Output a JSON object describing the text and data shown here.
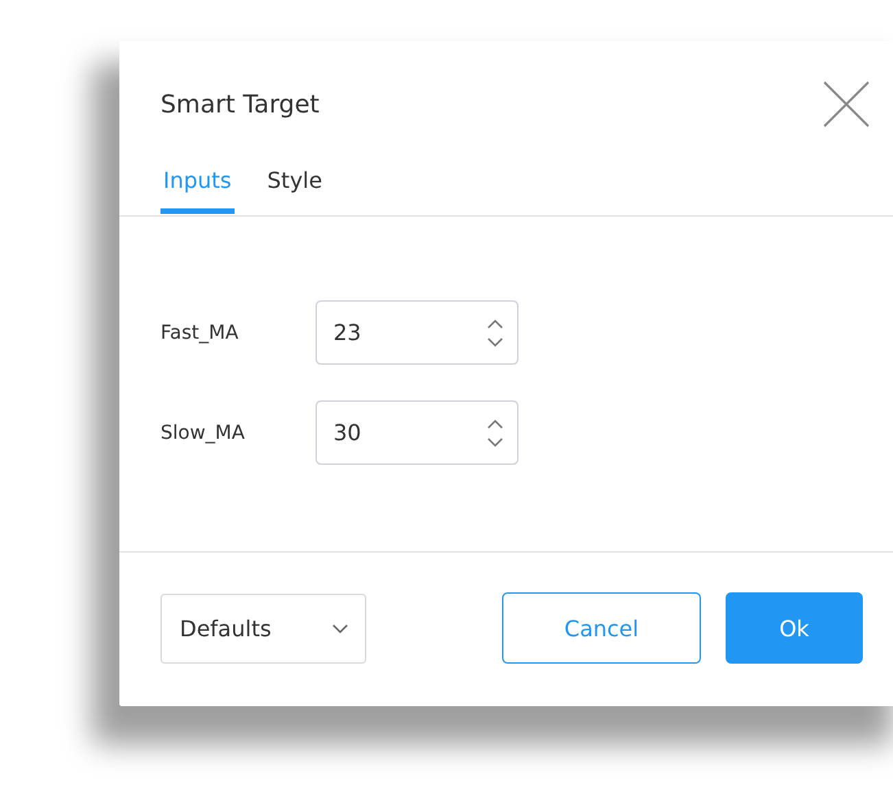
{
  "dialog": {
    "title": "Smart Target"
  },
  "tabs": [
    {
      "label": "Inputs",
      "selected": true
    },
    {
      "label": "Style",
      "selected": false
    }
  ],
  "fields": [
    {
      "label": "Fast_MA",
      "value": "23"
    },
    {
      "label": "Slow_MA",
      "value": "30"
    }
  ],
  "defaults": {
    "label": "Defaults"
  },
  "buttons": [
    {
      "label": "Cancel",
      "kind": "secondary"
    },
    {
      "label": "Ok",
      "kind": "primary"
    }
  ]
}
